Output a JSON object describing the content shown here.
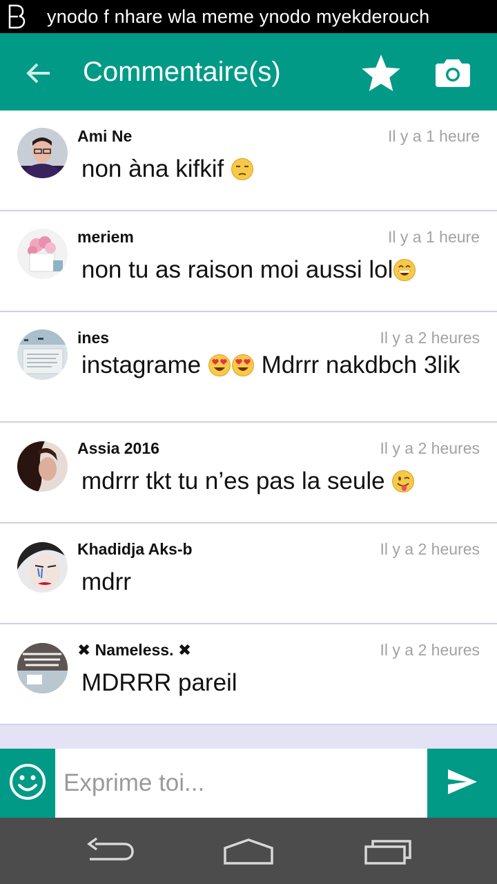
{
  "status_bar": {
    "notification": "ynodo f nhare wla meme ynodo myekderouch",
    "app_icon": "b-logo-icon"
  },
  "app_bar": {
    "title": "Commentaire(s)",
    "icons": [
      "back-arrow-icon",
      "star-icon",
      "camera-icon"
    ],
    "color": "#009a87"
  },
  "comments": [
    {
      "author": "Ami Ne",
      "time": "Il y a 1 heure",
      "text": "non àna kifkif",
      "emoji": [
        "unamused-face"
      ]
    },
    {
      "author": "meriem",
      "time": "Il y a 1 heure",
      "text": "non tu as raison moi aussi lol",
      "emoji": [
        "grinning-face"
      ]
    },
    {
      "author": "ines",
      "time": "Il y a 2 heures",
      "text_parts": [
        "instagrame ",
        " Mdrrr  nakdbch 3lik"
      ],
      "emoji": [
        "heart-eyes",
        "heart-eyes"
      ]
    },
    {
      "author": "Assia 2016",
      "time": "Il y a 2 heures",
      "text": "mdrrr tkt tu n’es pas la seule ",
      "emoji": [
        "winking-tongue"
      ]
    },
    {
      "author": "Khadidja Aks-b",
      "time": "Il y a 2 heures",
      "text": "mdrr"
    },
    {
      "author": "✖ Nameless. ✖",
      "time": "Il y a 2 heures",
      "text": "MDRRR pareil"
    }
  ],
  "composer": {
    "placeholder": "Exprime toi...",
    "emoji_button_icon": "smiley-icon",
    "send_button_icon": "send-icon"
  },
  "nav_bar": {
    "icons": [
      "back-nav-icon",
      "home-nav-icon",
      "recents-nav-icon"
    ]
  }
}
